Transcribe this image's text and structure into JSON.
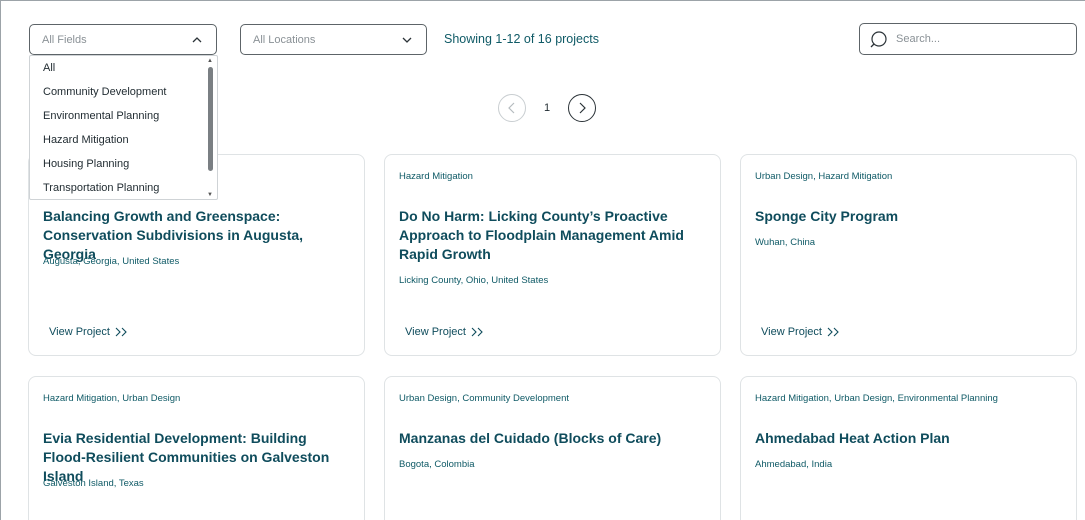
{
  "filters": {
    "field_placeholder": "All Fields",
    "location_placeholder": "All Locations",
    "showing_text": "Showing 1-12 of 16 projects",
    "search_placeholder": "Search..."
  },
  "field_dropdown": {
    "options": [
      "All",
      "Community Development",
      "Environmental Planning",
      "Hazard Mitigation",
      "Housing Planning",
      "Transportation Planning"
    ]
  },
  "pagination": {
    "current_page": "1"
  },
  "view_project_label": "View Project",
  "cards": [
    {
      "tags": "",
      "title": "Balancing Growth and Greenspace: Conservation Subdivisions in Augusta, Georgia",
      "location": "Augusta, Georgia, United States"
    },
    {
      "tags": "Hazard Mitigation",
      "title": "Do No Harm: Licking County’s Proactive Approach to Floodplain Management Amid Rapid Growth",
      "location": "Licking County, Ohio, United States"
    },
    {
      "tags": "Urban Design, Hazard Mitigation",
      "title": "Sponge City Program",
      "location": "Wuhan, China"
    },
    {
      "tags": "Hazard Mitigation, Urban Design",
      "title": "Evia Residential Development: Building Flood-Resilient Communities on Galveston Island",
      "location": "Galveston Island, Texas"
    },
    {
      "tags": "Urban Design, Community Development",
      "title": "Manzanas del Cuidado (Blocks of Care)",
      "location": "Bogota, Colombia"
    },
    {
      "tags": "Hazard Mitigation, Urban Design, Environmental Planning",
      "title": "Ahmedabad Heat Action Plan",
      "location": "Ahmedabad, India"
    }
  ]
}
